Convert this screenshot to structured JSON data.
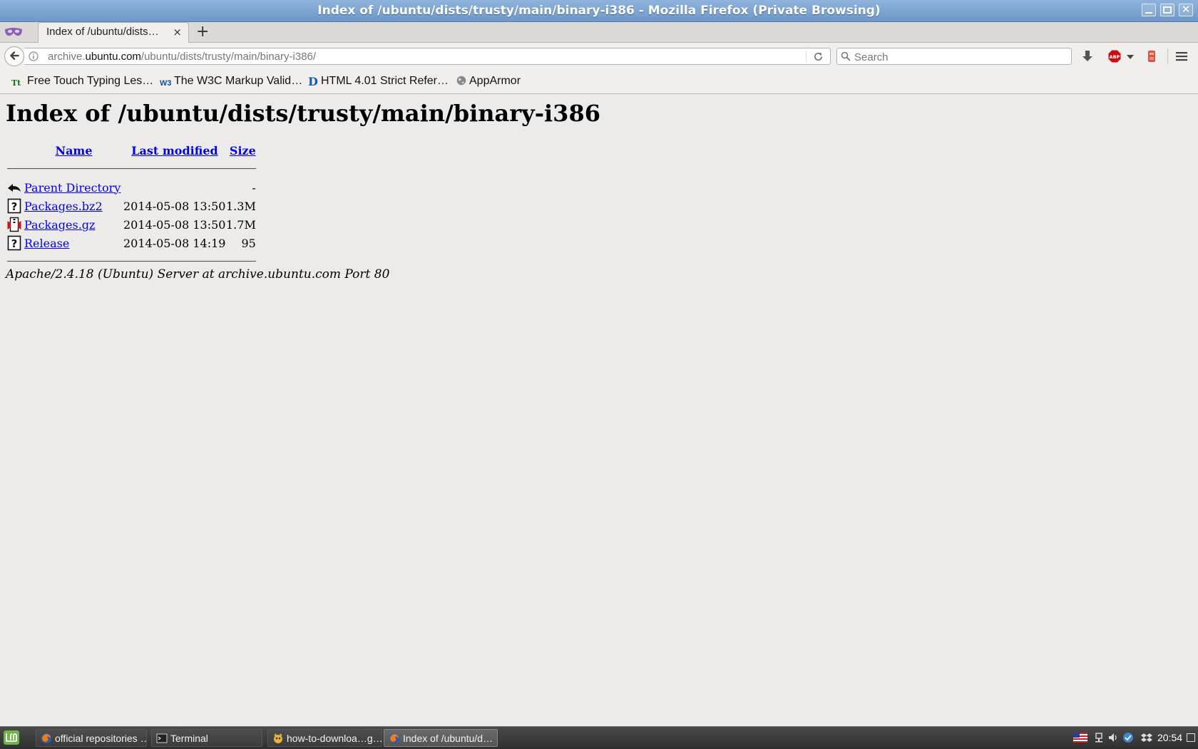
{
  "window": {
    "title": "Index of /ubuntu/dists/trusty/main/binary-i386 - Mozilla Firefox (Private Browsing)",
    "close_glyph": "✕"
  },
  "tabs": {
    "active_label": "Index of /ubuntu/dists…",
    "close_glyph": "×",
    "new_tab_glyph": "+"
  },
  "nav": {
    "url_prefix": "archive.",
    "url_domain": "ubuntu.com",
    "url_path": "/ubuntu/dists/trusty/main/binary-i386/",
    "search_placeholder": "Search"
  },
  "bookmarks": [
    {
      "icon": "typing-tt-icon",
      "icon_text": "Tt",
      "label": "Free Touch Typing Les…"
    },
    {
      "icon": "w3c-icon",
      "icon_text": "W3",
      "label": "The W3C Markup Valid…"
    },
    {
      "icon": "html-d-icon",
      "icon_text": "D",
      "label": "HTML 4.01 Strict Refer…"
    },
    {
      "icon": "globe-icon",
      "icon_text": "",
      "label": "AppArmor"
    }
  ],
  "page": {
    "title": "Index of /ubuntu/dists/trusty/main/binary-i386",
    "columns": {
      "name": "Name",
      "last_modified": "Last modified",
      "size": "Size"
    },
    "rows": [
      {
        "icon": "back-arrow-icon",
        "name": "Parent Directory",
        "modified": "",
        "size": "-"
      },
      {
        "icon": "unknown-file-icon",
        "name": "Packages.bz2",
        "modified": "2014-05-08 13:50",
        "size": "1.3M"
      },
      {
        "icon": "compressed-file-icon",
        "name": "Packages.gz",
        "modified": "2014-05-08 13:50",
        "size": "1.7M"
      },
      {
        "icon": "unknown-file-icon",
        "name": "Release",
        "modified": "2014-05-08 14:19",
        "size": "95"
      }
    ],
    "address": "Apache/2.4.18 (Ubuntu) Server at archive.ubuntu.com Port 80"
  },
  "taskbar": {
    "tasks": [
      {
        "label": "official repositories …",
        "icon": "firefox-icon",
        "active": false
      },
      {
        "label": "Terminal",
        "icon": "terminal-icon",
        "active": false
      },
      {
        "label": "how-to-downloa…g…",
        "icon": "image-viewer-icon",
        "active": false
      },
      {
        "label": "Index of /ubuntu/d…",
        "icon": "firefox-icon",
        "active": true
      }
    ],
    "clock": "20:54"
  },
  "colors": {
    "link": "#0000ee",
    "titlebar": "#7aa2d2",
    "page_background": "#edebe9",
    "taskbar": "#3a3a3a"
  }
}
